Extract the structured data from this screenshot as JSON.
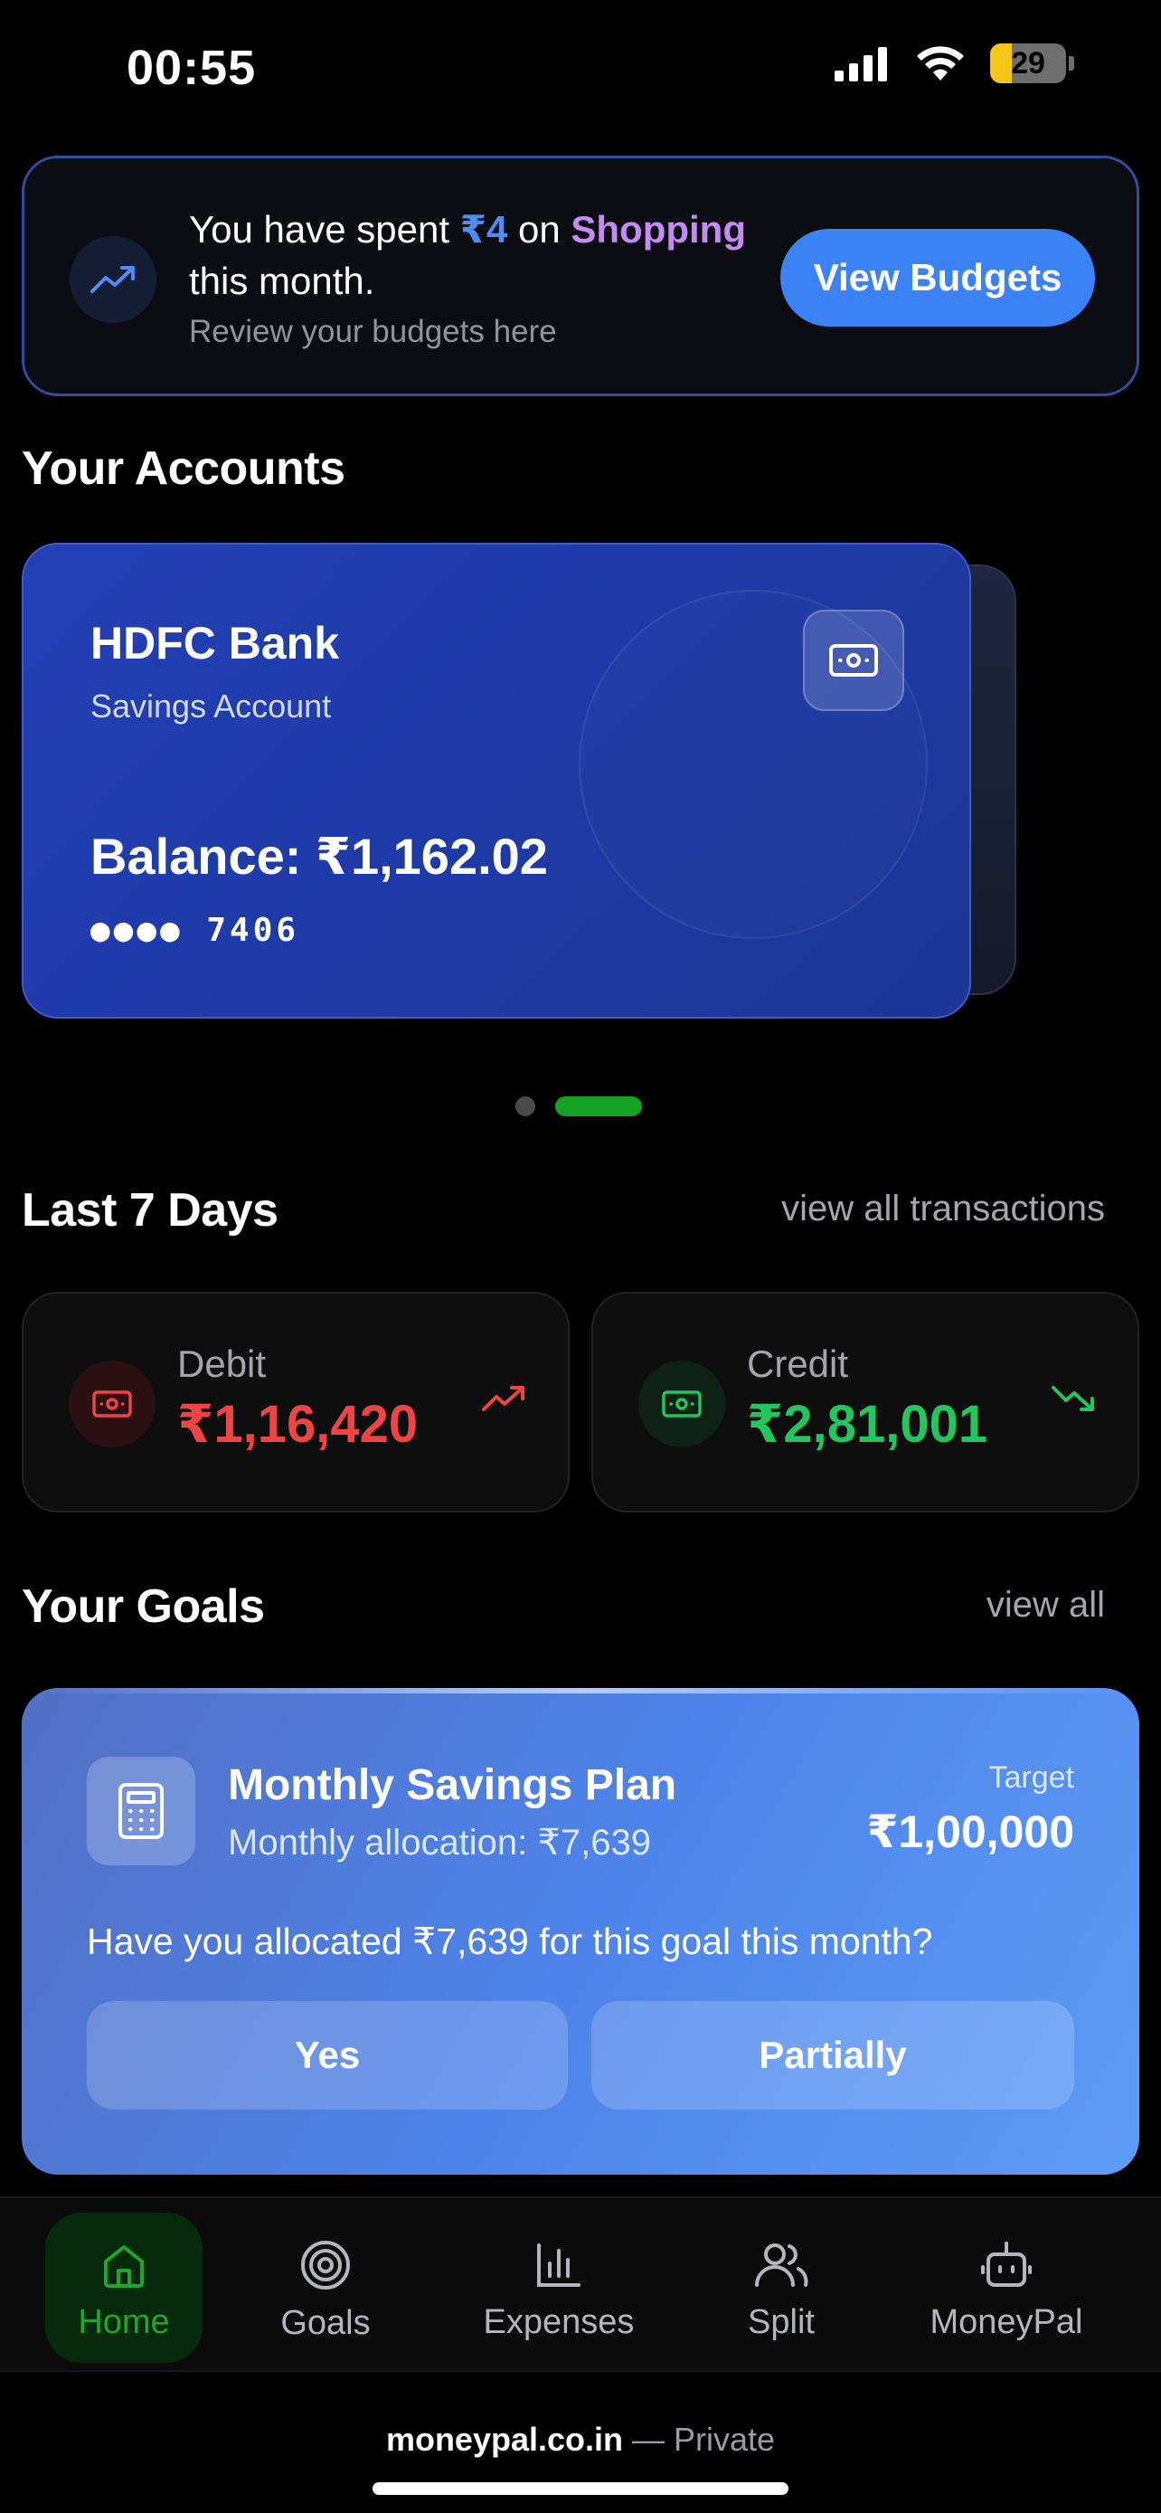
{
  "status_bar": {
    "time": "00:55",
    "battery": "29",
    "battery_level": 0.29
  },
  "banner": {
    "text_prefix": "You have spent",
    "amount": "₹4",
    "text_mid": "on",
    "category": "Shopping",
    "text_line2": "this month.",
    "subtitle": "Review your budgets here",
    "button": "View Budgets",
    "icon": "trending-up-icon"
  },
  "accounts": {
    "title": "Your Accounts",
    "card": {
      "bank": "HDFC Bank",
      "type": "Savings Account",
      "balance": "Balance: ₹1,162.02",
      "mask": "●●●● 7406",
      "icon": "banknote-icon"
    },
    "pagination": {
      "count": 2,
      "active": 1
    }
  },
  "last7": {
    "title": "Last 7 Days",
    "link": "view all transactions",
    "debit": {
      "label": "Debit",
      "value": "₹1,16,420",
      "color": "#ef4444"
    },
    "credit": {
      "label": "Credit",
      "value": "₹2,81,001",
      "color": "#22c55e"
    }
  },
  "goals": {
    "title": "Your Goals",
    "link": "view all",
    "goal": {
      "name": "Monthly Savings Plan",
      "allocation": "Monthly allocation: ₹7,639",
      "target_label": "Target",
      "target": "₹1,00,000",
      "question": "Have you allocated ₹7,639 for this goal this month?",
      "yes": "Yes",
      "partially": "Partially",
      "icon": "calculator-icon"
    }
  },
  "nav": {
    "home": "Home",
    "goals": "Goals",
    "expenses": "Expenses",
    "split": "Split",
    "moneypal": "MoneyPal",
    "active": "home",
    "active_color": "#20a52e"
  },
  "browser": {
    "domain": "moneypal.co.in",
    "suffix": "— Private"
  }
}
